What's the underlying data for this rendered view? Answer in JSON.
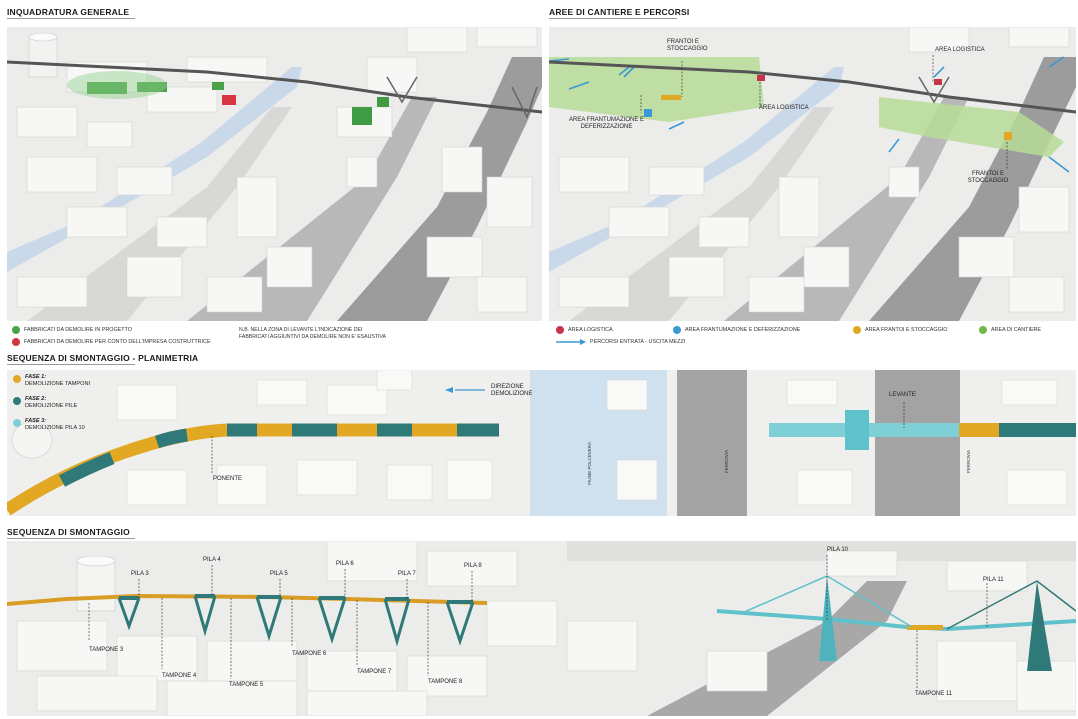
{
  "sections": {
    "general": "INQUADRATURA GENERALE",
    "areas": "AREE DI CANTIERE E PERCORSI",
    "plan": "SEQUENZA DI SMONTAGGIO - PLANIMETRIA",
    "sequence": "SEQUENZA DI SMONTAGGIO"
  },
  "general_legend": {
    "project": {
      "label": "FABBRICATI DA DEMOLIRE IN PROGETTO",
      "color": "#4aa148"
    },
    "contractor": {
      "label": "FABBRICATI DA DEMOLIRE PER CONTO DELL'IMPRESA COSTRUTTRICE",
      "color": "#d6363f"
    },
    "note_line1": "N.B. NELLA ZONA DI LEVANTE L'INDICAZIONE DEI",
    "note_line2": "FABBRICATI AGGIUNTIVI DA DEMOLIRE NON E' ESAUSTIVA"
  },
  "areas_map": {
    "frantoi_1": "FRANTOI E STOCCAGGIO",
    "logistica_1": "AREA LOGISTICA",
    "logistica_2": "AREA LOGISTICA",
    "frantumazione": "AREA FRANTUMAZIONE E DEFERIZZAZIONE",
    "frantoi_2": "FRANTOI E STOCCAGGIO"
  },
  "areas_legend": {
    "logistica": {
      "label": "AREA LOGISTICA",
      "color": "#c8334a"
    },
    "frantumazione": {
      "label": "AREA FRANTUMAZIONE E DEFERIZZAZIONE",
      "color": "#3a98d6"
    },
    "frantoi": {
      "label": "AREA FRANTOI E STOCCAGGIO",
      "color": "#e3a823"
    },
    "cantiere": {
      "label": "AREA DI CANTIERE",
      "color": "#6fb84c"
    },
    "percorsi": {
      "label": "PERCORSI ENTRATA - USCITA MEZZI",
      "color": "#3a98d6"
    }
  },
  "plan": {
    "phase1": {
      "title": "FASE 1:",
      "desc": "DEMOLIZIONE TAMPONI",
      "color": "#e3a823"
    },
    "phase2": {
      "title": "FASE 2:",
      "desc": "DEMOLIZIONE PILE",
      "color": "#2f7a78"
    },
    "phase3": {
      "title": "FASE 3:",
      "desc": "DEMOLIZIONE PILA 10",
      "color": "#7fcfd6"
    },
    "direction_line1": "DIREZIONE",
    "direction_line2": "DEMOLIZIONE",
    "ponente": "PONENTE",
    "levante": "LEVANTE",
    "fiume": "FIUME POLCEVERA",
    "ferrovia_1": "FERROVIA",
    "ferrovia_2": "FERROVIA"
  },
  "sequence": {
    "pila3": "PILA 3",
    "pila4": "PILA 4",
    "pila5": "PILA 5",
    "pila6": "PILA 6",
    "pila7": "PILA 7",
    "pila8": "PILA 8",
    "pila10": "PILA 10",
    "pila11": "PILA 11",
    "tampone3": "TAMPONE 3",
    "tampone4": "TAMPONE 4",
    "tampone5": "TAMPONE 5",
    "tampone6": "TAMPONE 6",
    "tampone7": "TAMPONE 7",
    "tampone8": "TAMPONE 8",
    "tampone11": "TAMPONE 11"
  }
}
